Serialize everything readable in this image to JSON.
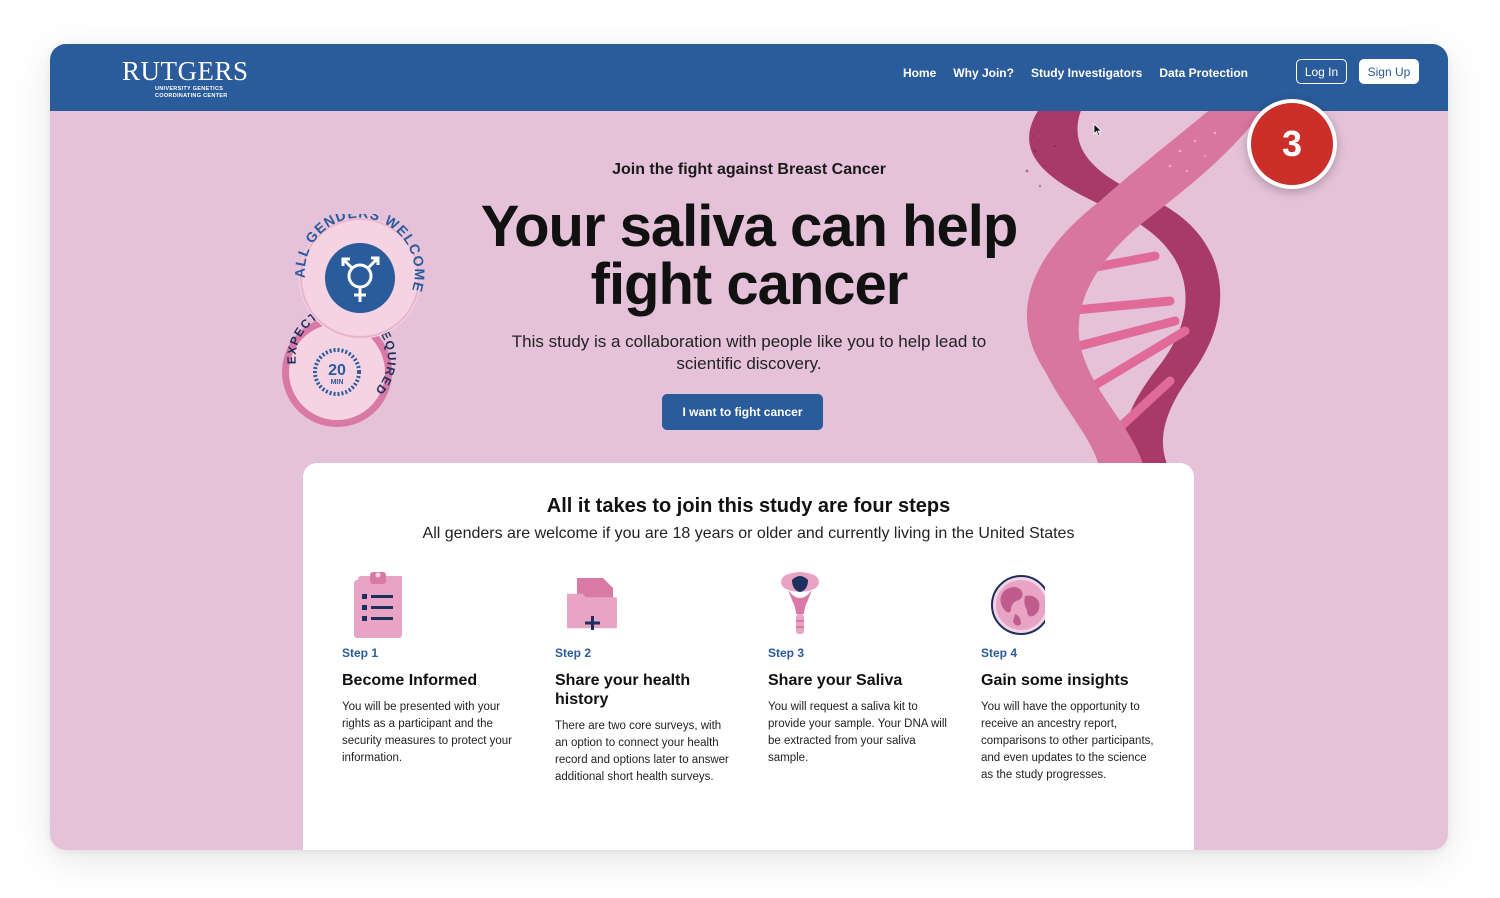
{
  "header": {
    "logo_word": "RUTGERS",
    "logo_sub_1": "UNIVERSITY GENETICS",
    "logo_sub_2": "COORDINATING CENTER",
    "nav": [
      "Home",
      "Why Join?",
      "Study Investigators",
      "Data Protection"
    ],
    "login_label": "Log In",
    "signup_label": "Sign Up"
  },
  "hero": {
    "eyebrow": "Join the fight against Breast Cancer",
    "title": "Your saliva can help fight cancer",
    "subtitle": "This study is a collaboration with people like you to help lead to scientific discovery.",
    "cta_label": "I want to fight cancer",
    "badge_genders": "ALL GENDERS WELCOME",
    "badge_time_number": "20",
    "badge_time_unit": "MIN",
    "badge_time_ring": "EXPECTED TIME REQUIRED"
  },
  "overlay": {
    "step_marker": "3"
  },
  "steps_section": {
    "title": "All it takes to join this study are four steps",
    "subtitle": "All genders are welcome if you are 18 years or older and currently living in the United States",
    "steps": [
      {
        "icon": "clipboard-checklist-icon",
        "num": "Step 1",
        "title": "Become Informed",
        "desc": "You will be presented with your rights as a participant and the security measures to protect your information."
      },
      {
        "icon": "medical-folder-icon",
        "num": "Step 2",
        "title": "Share your health history",
        "desc": "There are two core surveys, with an option to connect your health record and options later to answer additional short health surveys."
      },
      {
        "icon": "saliva-tube-icon",
        "num": "Step 3",
        "title": "Share your Saliva",
        "desc": "You will request a saliva kit to provide your sample. Your DNA will be extracted from your saliva sample."
      },
      {
        "icon": "globe-icon",
        "num": "Step 4",
        "title": "Gain some insights",
        "desc": "You will have the opportunity to receive an ancestry report, comparisons to other participants, and even updates to the science as the study progresses."
      }
    ]
  },
  "colors": {
    "brand_blue": "#2a5b9b",
    "hero_pink": "#e5c2da",
    "marker_red": "#cc2f2a",
    "accent_pink": "#d97aa6"
  }
}
